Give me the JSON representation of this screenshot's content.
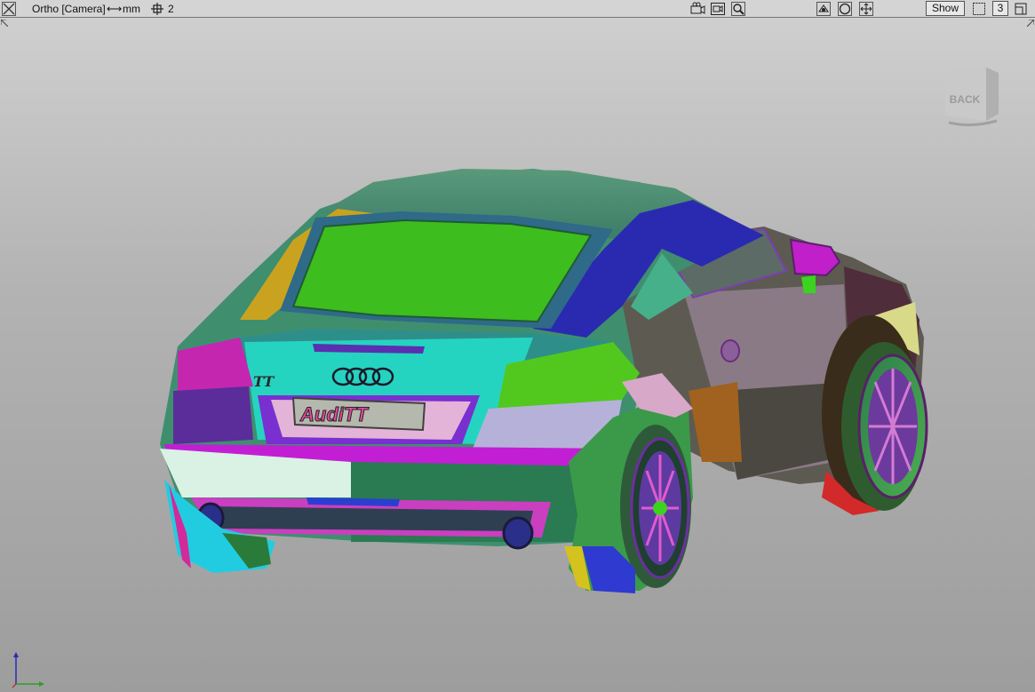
{
  "toolbar": {
    "projection": "Ortho [Camera]",
    "units": "mm",
    "grid_value": "2",
    "show_label": "Show",
    "count_value": "3",
    "icons": [
      "close-icon",
      "camera-icon",
      "camera-settings-icon",
      "zoom-icon",
      "fit-view-icon",
      "sphere-view-icon",
      "pan-icon",
      "window-icon",
      "maximize-icon"
    ]
  },
  "viewport": {
    "viewcube_face": "BACK",
    "model_badge_left": "TT",
    "license_plate": "AudiTT"
  },
  "colors": {
    "background_top": "#cfcfcf",
    "background_bottom": "#9d9d9d",
    "toolbar": "#d4d4d4"
  }
}
